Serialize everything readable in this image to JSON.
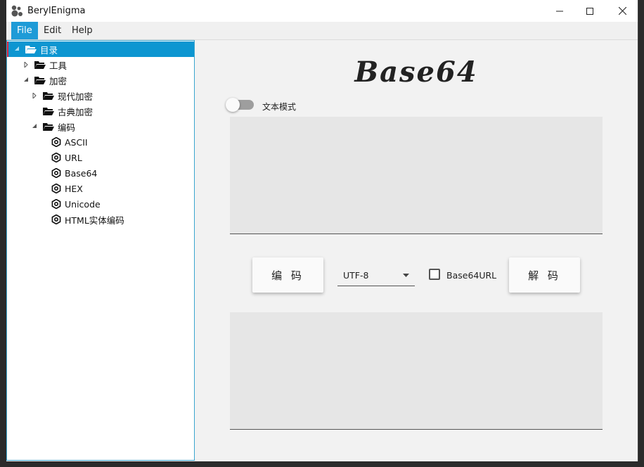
{
  "window": {
    "title": "BerylEnigma",
    "controls": {
      "minimize": "minimize-icon",
      "maximize": "maximize-icon",
      "close": "close-icon"
    }
  },
  "menubar": {
    "items": [
      "File",
      "Edit",
      "Help"
    ],
    "active": "File"
  },
  "tree": {
    "items": [
      {
        "label": "目录",
        "depth": 0,
        "icon": "folder-open-icon",
        "expanded": true,
        "selected": true
      },
      {
        "label": "工具",
        "depth": 1,
        "icon": "folder-open-icon",
        "expanded": false
      },
      {
        "label": "加密",
        "depth": 1,
        "icon": "folder-open-icon",
        "expanded": true
      },
      {
        "label": "现代加密",
        "depth": 2,
        "icon": "folder-open-icon",
        "expanded": false
      },
      {
        "label": "古典加密",
        "depth": 2,
        "icon": "folder-open-icon",
        "leaf": true
      },
      {
        "label": "编码",
        "depth": 2,
        "icon": "folder-open-icon",
        "expanded": true
      },
      {
        "label": "ASCII",
        "depth": 3,
        "icon": "gear-icon"
      },
      {
        "label": "URL",
        "depth": 3,
        "icon": "gear-icon"
      },
      {
        "label": "Base64",
        "depth": 3,
        "icon": "gear-icon"
      },
      {
        "label": "HEX",
        "depth": 3,
        "icon": "gear-icon"
      },
      {
        "label": "Unicode",
        "depth": 3,
        "icon": "gear-icon"
      },
      {
        "label": "HTML实体编码",
        "depth": 3,
        "icon": "gear-icon"
      }
    ]
  },
  "main": {
    "title": "Base64",
    "text_mode_label": "文本模式",
    "text_mode_on": false,
    "input_value": "",
    "encode_label": "编 码",
    "charset": {
      "selected": "UTF-8"
    },
    "base64url_label": "Base64URL",
    "base64url_checked": false,
    "decode_label": "解 码",
    "output_value": ""
  },
  "colors": {
    "accent": "#0d96d1",
    "selection_marker": "#e0213b",
    "text_area": "#e6e6e6"
  }
}
